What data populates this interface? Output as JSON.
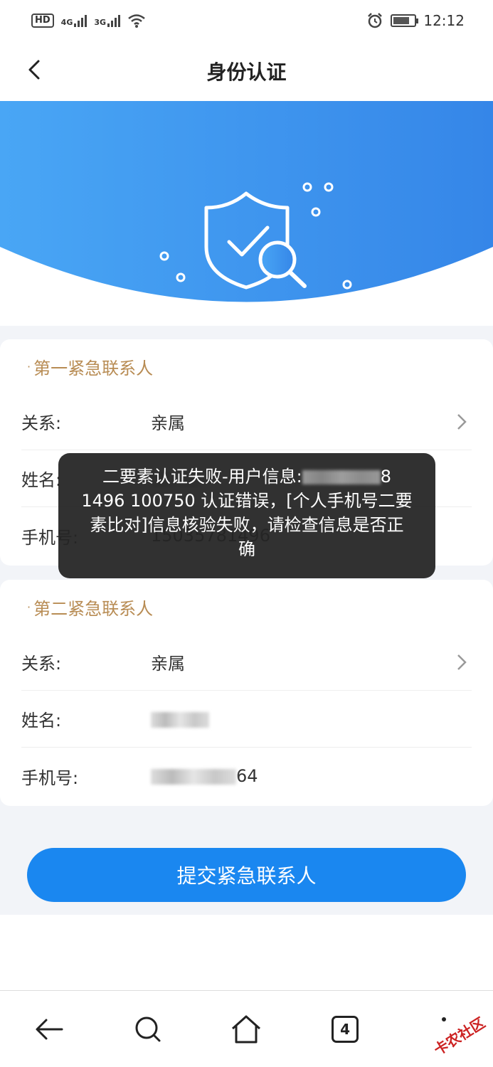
{
  "status_bar": {
    "hd": "HD",
    "net1": "4G",
    "net2": "3G",
    "time": "12:12"
  },
  "nav": {
    "title": "身份认证"
  },
  "contact1": {
    "title": "第一紧急联系人",
    "relation_label": "关系:",
    "relation_value": "亲属",
    "name_label": "姓名:",
    "phone_label": "手机号:",
    "phone_value": "15035781496"
  },
  "contact2": {
    "title": "第二紧急联系人",
    "relation_label": "关系:",
    "relation_value": "亲属",
    "name_label": "姓名:",
    "phone_label": "手机号:",
    "phone_suffix": "64"
  },
  "toast": {
    "line1": "二要素认证失败-用户信息:",
    "line1_end": "8",
    "line2": "1496 100750 认证错误，[个人手机号二要",
    "line3": "素比对]信息核验失败，请检查信息是否正",
    "line4": "确"
  },
  "submit_label": "提交紧急联系人",
  "browser": {
    "tabs_count": "4",
    "watermark": "卡农社区"
  },
  "colors": {
    "primary": "#1a87f0",
    "accent_gold": "#b88c54",
    "toast_bg": "#242424"
  }
}
